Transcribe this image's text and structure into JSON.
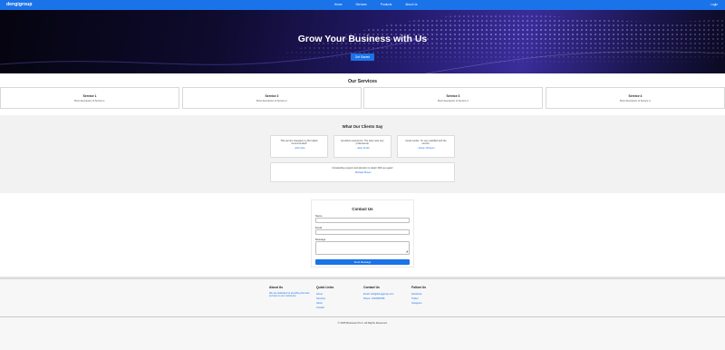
{
  "navbar": {
    "logo": "dengigroup",
    "links": [
      "Home",
      "Services",
      "Products",
      "About Us"
    ],
    "login": "Login"
  },
  "hero": {
    "title": "Grow Your Business with Us",
    "cta": "Get Started"
  },
  "services": {
    "title": "Our Services",
    "items": [
      {
        "name": "Service 1",
        "desc": "Short description of Service 1."
      },
      {
        "name": "Service 2",
        "desc": "Short description of Service 2."
      },
      {
        "name": "Service 3",
        "desc": "Short description of Service 3."
      },
      {
        "name": "Service 4",
        "desc": "Short description of Service 4."
      }
    ]
  },
  "testimonials": {
    "title": "What Our Clients Say",
    "items": [
      {
        "quote": "This service changed my life! Highly recommended!",
        "author": "- John Doe"
      },
      {
        "quote": "Excellent experience. The team was very professional.",
        "author": "- Jane Smith"
      },
      {
        "quote": "Great results. I'm very satisfied with the service.",
        "author": "- Emily Johnson"
      },
      {
        "quote": "Outstanding support and attention to detail. Will use again!",
        "author": "- Michael Brown"
      }
    ]
  },
  "contact": {
    "title": "Contact Us",
    "name_label": "Name",
    "email_label": "Email",
    "message_label": "Message",
    "submit": "Send Message"
  },
  "footer": {
    "about": {
      "heading": "About Us",
      "text": "We are dedicated to providing the best services to our customers."
    },
    "quick_links": {
      "heading": "Quick Links",
      "links": [
        "Home",
        "Services",
        "About",
        "Contact"
      ]
    },
    "contact": {
      "heading": "Contact Us",
      "email": "Email: info@dengigroup.com",
      "phone": "Phone: 0123456789"
    },
    "follow": {
      "heading": "Follow Us",
      "links": [
        "Facebook",
        "Twitter",
        "Instagram"
      ]
    },
    "copyright": "© 2025 Business Pro's. All Rights Reserved."
  },
  "colors": {
    "primary": "#1a73e8",
    "hero_dark": "#0b0a22",
    "hero_accent": "#3a2d9a",
    "section_gray": "#f2f2f2"
  }
}
